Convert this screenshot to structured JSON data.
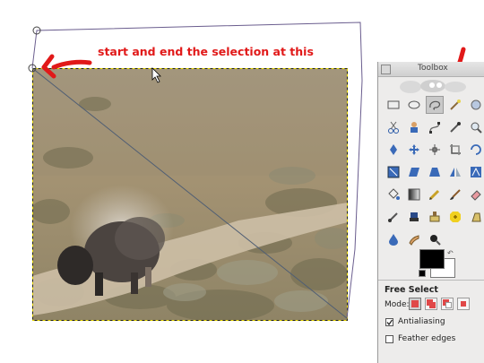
{
  "annotation": {
    "text": "start and end the selection at this",
    "color": "#e11919"
  },
  "canvas": {
    "image": "bison in dust on dirt path among sagebrush",
    "selection_tool": "free-select"
  },
  "toolbox": {
    "title": "Toolbox",
    "tools": [
      "rect-select-icon",
      "ellipse-select-icon",
      "free-select-icon",
      "fuzzy-select-icon",
      "color-select-icon",
      "scissors-icon",
      "foreground-select-icon",
      "paths-icon",
      "color-picker-icon",
      "zoom-icon",
      "measure-icon",
      "move-icon",
      "align-icon",
      "crop-icon",
      "rotate-icon",
      "scale-icon",
      "shear-icon",
      "perspective-icon",
      "flip-icon",
      "cage-icon",
      "bucket-fill-icon",
      "blend-icon",
      "pencil-icon",
      "paintbrush-icon",
      "eraser-icon",
      "airbrush-icon",
      "ink-icon",
      "clone-icon",
      "heal-icon",
      "perspective-clone-icon",
      "blur-icon",
      "smudge-icon",
      "dodge-burn-icon"
    ],
    "active_tool": "free-select-icon",
    "foreground_color": "#000000",
    "background_color": "#ffffff",
    "options": {
      "section_title": "Free Select",
      "mode_label": "Mode:",
      "antialiasing_label": "Antialiasing",
      "antialiasing_checked": true,
      "feather_label": "Feather edges",
      "feather_checked": false
    }
  }
}
